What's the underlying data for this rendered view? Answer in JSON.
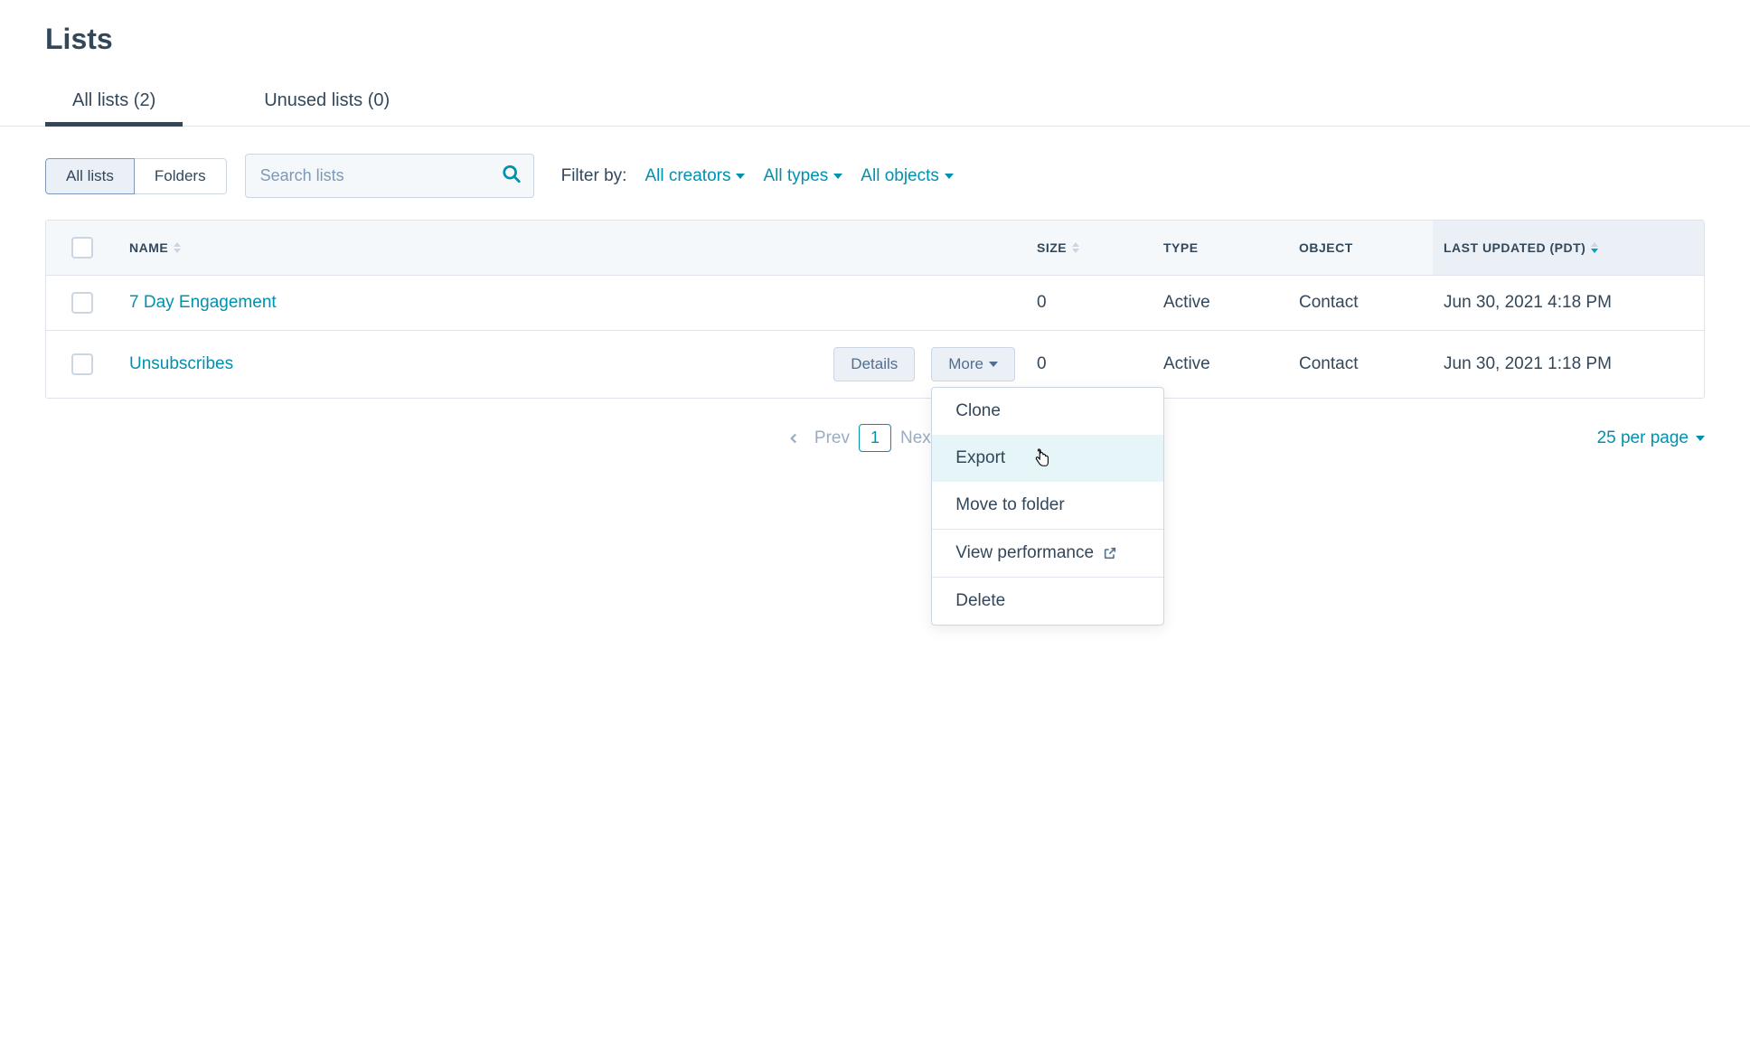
{
  "page_title": "Lists",
  "tabs": [
    {
      "label": "All lists (2)"
    },
    {
      "label": "Unused lists (0)"
    }
  ],
  "view_toggle": {
    "all_lists": "All lists",
    "folders": "Folders"
  },
  "search": {
    "placeholder": "Search lists"
  },
  "filter_label": "Filter by:",
  "filters": {
    "creators": "All creators",
    "types": "All types",
    "objects": "All objects"
  },
  "columns": {
    "name": "NAME",
    "size": "SIZE",
    "type": "TYPE",
    "object": "OBJECT",
    "updated": "LAST UPDATED (PDT)"
  },
  "rows": [
    {
      "name": "7 Day Engagement",
      "size": "0",
      "type": "Active",
      "object": "Contact",
      "updated": "Jun 30, 2021 4:18 PM"
    },
    {
      "name": "Unsubscribes",
      "size": "0",
      "type": "Active",
      "object": "Contact",
      "updated": "Jun 30, 2021 1:18 PM"
    }
  ],
  "row_actions": {
    "details": "Details",
    "more": "More"
  },
  "more_menu": {
    "clone": "Clone",
    "export": "Export",
    "move": "Move to folder",
    "performance": "View performance",
    "delete": "Delete"
  },
  "pagination": {
    "prev": "Prev",
    "page": "1",
    "next": "Next",
    "per_page": "25 per page"
  }
}
